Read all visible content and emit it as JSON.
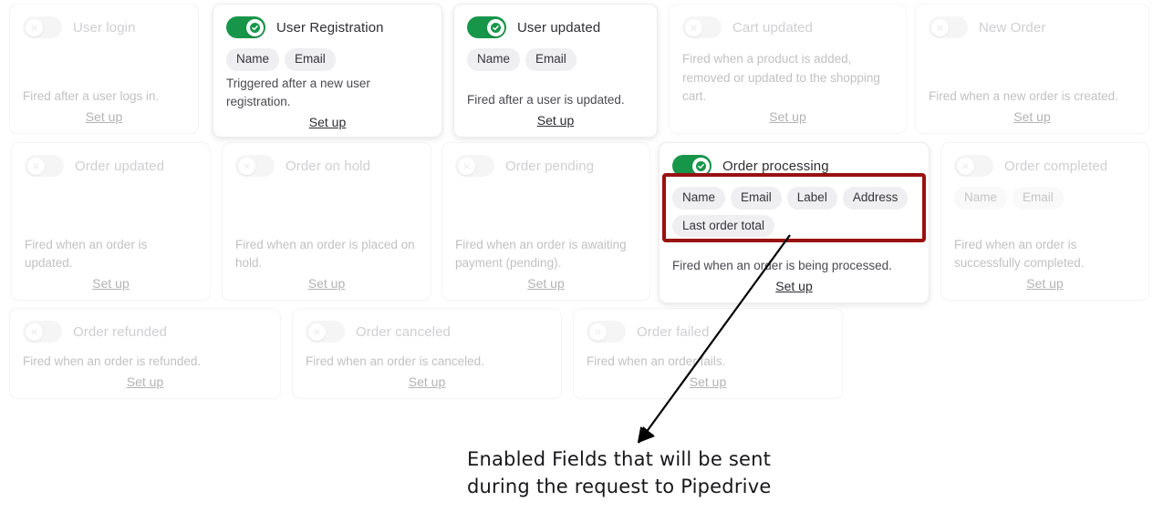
{
  "labels": {
    "setup": "Set up",
    "toggle_on_icon": "check-icon",
    "toggle_off_icon": "close-icon"
  },
  "annotation": {
    "line1": "Enabled Fields that will be sent",
    "line2": "during the request to Pipedrive",
    "highlight_color": "#991112",
    "arrow_color": "#000000"
  },
  "colors": {
    "toggle_on": "#17964a",
    "toggle_off": "#e9e9ec",
    "tag_bg": "#efeff1"
  },
  "cards": [
    {
      "id": "user-login",
      "title": "User login",
      "enabled": false,
      "tags": [],
      "description": "Fired after a user logs in.",
      "setup_label": "Set up"
    },
    {
      "id": "user-registration",
      "title": "User Registration",
      "enabled": true,
      "tags": [
        "Name",
        "Email"
      ],
      "description": "Triggered after a new user registration.",
      "setup_label": "Set up"
    },
    {
      "id": "user-updated",
      "title": "User updated",
      "enabled": true,
      "tags": [
        "Name",
        "Email"
      ],
      "description": "Fired after a user is updated.",
      "setup_label": "Set up"
    },
    {
      "id": "cart-updated",
      "title": "Cart updated",
      "enabled": false,
      "tags": [],
      "description": "Fired when a product is added, removed or updated to the shopping cart.",
      "setup_label": "Set up"
    },
    {
      "id": "new-order",
      "title": "New Order",
      "enabled": false,
      "tags": [],
      "description": "Fired when a new order is created.",
      "setup_label": "Set up"
    },
    {
      "id": "order-updated",
      "title": "Order updated",
      "enabled": false,
      "tags": [],
      "description": "Fired when an order is updated.",
      "setup_label": "Set up"
    },
    {
      "id": "order-on-hold",
      "title": "Order on hold",
      "enabled": false,
      "tags": [],
      "description": "Fired when an order is placed on hold.",
      "setup_label": "Set up"
    },
    {
      "id": "order-pending",
      "title": "Order pending",
      "enabled": false,
      "tags": [],
      "description": "Fired when an order is awaiting payment (pending).",
      "setup_label": "Set up"
    },
    {
      "id": "order-processing",
      "title": "Order processing",
      "enabled": true,
      "tags": [
        "Name",
        "Email",
        "Label",
        "Address",
        "Last order total"
      ],
      "description": "Fired when an order is being processed.",
      "setup_label": "Set up"
    },
    {
      "id": "order-completed",
      "title": "Order completed",
      "enabled": false,
      "tags": [
        "Name",
        "Email"
      ],
      "description": "Fired when an order is successfully completed.",
      "setup_label": "Set up"
    },
    {
      "id": "order-refunded",
      "title": "Order refunded",
      "enabled": false,
      "tags": [],
      "description": "Fired when an order is refunded.",
      "setup_label": "Set up"
    },
    {
      "id": "order-canceled",
      "title": "Order canceled",
      "enabled": false,
      "tags": [],
      "description": "Fired when an order is canceled.",
      "setup_label": "Set up"
    },
    {
      "id": "order-failed",
      "title": "Order failed",
      "enabled": false,
      "tags": [],
      "description": "Fired when an order fails.",
      "setup_label": "Set up"
    }
  ]
}
